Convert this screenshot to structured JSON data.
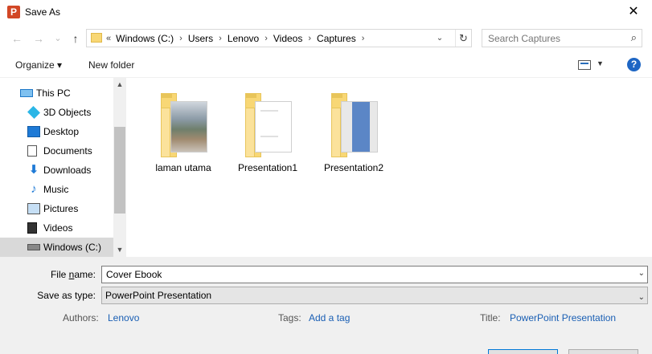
{
  "window": {
    "title": "Save As",
    "app_icon_letter": "P",
    "close_glyph": "✕"
  },
  "nav": {
    "back_glyph": "←",
    "forward_glyph": "→",
    "recent_glyph": "⌄",
    "up_glyph": "↑",
    "more_glyph": "«",
    "crumbs": [
      "Windows (C:)",
      "Users",
      "Lenovo",
      "Videos",
      "Captures"
    ],
    "sep_glyph": "›",
    "dropdown_glyph": "⌄",
    "refresh_glyph": "↻"
  },
  "search": {
    "placeholder": "Search Captures",
    "icon_glyph": "⌕"
  },
  "toolbar": {
    "organize_label": "Organize ▾",
    "new_folder_label": "New folder",
    "view_dd_glyph": "▼",
    "help_glyph": "?"
  },
  "sidebar": {
    "items": [
      {
        "label": "This PC",
        "icon": "computer-icon"
      },
      {
        "label": "3D Objects",
        "icon": "cube-icon"
      },
      {
        "label": "Desktop",
        "icon": "desktop-icon"
      },
      {
        "label": "Documents",
        "icon": "document-icon"
      },
      {
        "label": "Downloads",
        "icon": "download-arrow-icon"
      },
      {
        "label": "Music",
        "icon": "music-note-icon"
      },
      {
        "label": "Pictures",
        "icon": "picture-icon"
      },
      {
        "label": "Videos",
        "icon": "film-icon"
      },
      {
        "label": "Windows (C:)",
        "icon": "drive-icon"
      }
    ],
    "selected": "Windows (C:)",
    "scroll_up_glyph": "▲",
    "scroll_down_glyph": "▼"
  },
  "files": [
    {
      "name": "laman utama",
      "icon": "folder-icon"
    },
    {
      "name": "Presentation1",
      "icon": "folder-icon"
    },
    {
      "name": "Presentation2",
      "icon": "folder-icon"
    }
  ],
  "form": {
    "filename_label_pre": "File ",
    "filename_label_ul": "n",
    "filename_label_post": "ame:",
    "filename_value": "Cover Ebook",
    "savetype_label": "Save as type:",
    "savetype_value": "PowerPoint Presentation",
    "dd_glyph": "⌄",
    "authors_label": "Authors:",
    "authors_value": "Lenovo",
    "tags_label": "Tags:",
    "tags_value": "Add a tag",
    "title_label": "Title:",
    "title_value": "PowerPoint Presentation"
  },
  "colors": {
    "accent": "#0078d7",
    "link": "#1a5fb4",
    "selected": "#d9d9d9",
    "footer": "#f0f0f0"
  }
}
